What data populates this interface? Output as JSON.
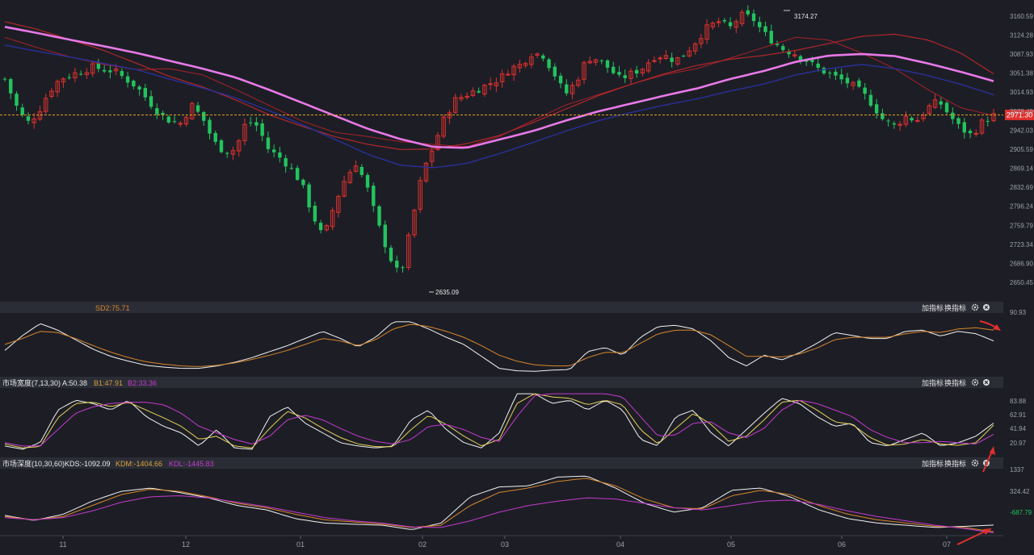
{
  "colors": {
    "background": "#1d1e25",
    "header_bar": "#2b2d36",
    "grid_text": "#9aa0aa",
    "up": "#e0302e",
    "down": "#22c45e",
    "ma_pink": "#e879e8",
    "ma_blue": "#2a2f9a",
    "ma_red": "#b3262b",
    "ma_thin_red": "#a8202a",
    "last_price_line": "#e0a020",
    "last_price_box": "#e0302e",
    "white_line": "#f2f2f2",
    "orange_line": "#d7862c",
    "magenta_line": "#c43ad0",
    "yellow_line": "#e6d25a",
    "arrow": "#e0302e",
    "green_text": "#22c45e"
  },
  "toolbar": {
    "add_label": "加指标",
    "switch_label": "换指标",
    "settings_icon": "gear-icon",
    "close_icon": "close-icon"
  },
  "x_axis": {
    "ticks": [
      "11",
      "12",
      "01",
      "02",
      "03",
      "04",
      "05",
      "06",
      "07"
    ]
  },
  "chart_data": [
    {
      "type": "candlestick",
      "panel": "price",
      "y_ticks": [
        "3160.59",
        "3124.28",
        "3087.93",
        "3051.38",
        "3014.93",
        "2978.49",
        "2942.03",
        "2905.59",
        "2869.14",
        "2832.69",
        "2796.24",
        "2759.79",
        "2723.34",
        "2686.90",
        "2650.45"
      ],
      "ylim": [
        2650.45,
        3160.59
      ],
      "last_price": "2971.30",
      "annotations": {
        "high": "3174.27",
        "low": "2635.09"
      },
      "anchors_close": [
        3040,
        2990,
        2955,
        2975,
        3015,
        3040,
        3048,
        3055,
        3063,
        3058,
        3055,
        3040,
        3025,
        3000,
        2975,
        2960,
        2955,
        2990,
        2965,
        2920,
        2900,
        2905,
        2960,
        2950,
        2905,
        2890,
        2870,
        2840,
        2780,
        2735,
        2800,
        2850,
        2880,
        2830,
        2760,
        2700,
        2660,
        2760,
        2860,
        2910,
        2965,
        3000,
        3010,
        3020,
        3030,
        3040,
        3060,
        3068,
        3090,
        3085,
        3050,
        3010,
        3035,
        3080,
        3078,
        3060,
        3040,
        3050,
        3060,
        3082,
        3085,
        3075,
        3090,
        3115,
        3140,
        3150,
        3138,
        3162,
        3158,
        3130,
        3110,
        3095,
        3088,
        3075,
        3060,
        3050,
        3040,
        3030,
        3015,
        2990,
        2960,
        2950,
        2968,
        2960,
        2985,
        2998,
        2970,
        2945,
        2932,
        2958,
        2970
      ],
      "ma_pink": [
        3140,
        3128,
        3115,
        3103,
        3090,
        3075,
        3060,
        3043,
        3020,
        2995,
        2970,
        2945,
        2925,
        2910,
        2908,
        2924,
        2940,
        2960,
        2978,
        2993,
        3008,
        3022,
        3040,
        3055,
        3073,
        3085,
        3088,
        3084,
        3070,
        3054,
        3036
      ],
      "ma_blue": [
        3105,
        3093,
        3082,
        3070,
        3058,
        3040,
        3023,
        3004,
        2980,
        2953,
        2925,
        2896,
        2875,
        2870,
        2878,
        2897,
        2918,
        2940,
        2960,
        2976,
        2990,
        3002,
        3017,
        3030,
        3048,
        3060,
        3068,
        3060,
        3047,
        3030,
        3010
      ],
      "ma_red": [
        3150,
        3135,
        3115,
        3095,
        3070,
        3045,
        3025,
        3000,
        2972,
        2950,
        2930,
        2915,
        2905,
        2906,
        2916,
        2932,
        2956,
        2982,
        3008,
        3030,
        3050,
        3066,
        3078,
        3085,
        3095,
        3108,
        3122,
        3126,
        3115,
        3090,
        3050
      ],
      "ma_thin_red": [
        3120,
        3100,
        3082,
        3068,
        3058,
        3060,
        3048,
        3020,
        2990,
        2960,
        2938,
        2930,
        2920,
        2915,
        2910,
        2930,
        2960,
        2990,
        3010,
        3030,
        3048,
        3060,
        3080,
        3100,
        3120,
        3115,
        3090,
        3060,
        3020,
        2985,
        2970
      ]
    },
    {
      "type": "line",
      "panel": "indicator_1",
      "legend": "SD2:75.71",
      "y_ticks": [
        "90.93"
      ],
      "series": [
        {
          "color": "white",
          "values": [
            40,
            65,
            85,
            74,
            58,
            42,
            30,
            22,
            15,
            12,
            10,
            10,
            14,
            20,
            28,
            38,
            48,
            60,
            72,
            60,
            46,
            62,
            88,
            88,
            76,
            62,
            50,
            30,
            10,
            6,
            5,
            7,
            8,
            38,
            45,
            32,
            62,
            80,
            82,
            76,
            56,
            28,
            14,
            32,
            24,
            36,
            52,
            70,
            65,
            60,
            60,
            72,
            74,
            64,
            72,
            68,
            56
          ]
        },
        {
          "color": "orange",
          "values": [
            50,
            60,
            72,
            70,
            60,
            48,
            37,
            28,
            21,
            17,
            14,
            13,
            15,
            19,
            25,
            32,
            40,
            50,
            60,
            56,
            48,
            58,
            76,
            84,
            80,
            72,
            62,
            48,
            32,
            22,
            16,
            14,
            14,
            28,
            37,
            36,
            52,
            68,
            74,
            74,
            66,
            48,
            30,
            30,
            29,
            34,
            44,
            58,
            62,
            62,
            62,
            68,
            72,
            70,
            76,
            78,
            74
          ]
        }
      ]
    },
    {
      "type": "line",
      "panel": "market_breadth",
      "legend": {
        "name": "市场宽度(7,13,30)",
        "A": "A:50.38",
        "B1": "B1:47.91",
        "B2": "B2:33.36"
      },
      "y_ticks": [
        "83.88",
        "62.91",
        "41.94",
        "20.97"
      ],
      "series": [
        {
          "name": "A",
          "color": "white",
          "values": [
            15,
            10,
            20,
            70,
            85,
            80,
            70,
            85,
            60,
            45,
            35,
            15,
            40,
            12,
            10,
            60,
            75,
            50,
            35,
            20,
            15,
            12,
            15,
            55,
            70,
            40,
            20,
            12,
            35,
            95,
            95,
            80,
            85,
            70,
            85,
            70,
            25,
            15,
            60,
            70,
            35,
            15,
            40,
            65,
            88,
            80,
            60,
            45,
            50,
            20,
            15,
            25,
            35,
            15,
            20,
            30,
            50
          ]
        },
        {
          "name": "B1",
          "color": "yellow",
          "values": [
            18,
            12,
            14,
            58,
            80,
            82,
            75,
            82,
            70,
            58,
            45,
            25,
            30,
            15,
            12,
            42,
            68,
            58,
            42,
            28,
            18,
            14,
            14,
            40,
            62,
            48,
            30,
            15,
            25,
            80,
            95,
            90,
            88,
            78,
            85,
            78,
            40,
            18,
            42,
            65,
            48,
            22,
            30,
            55,
            82,
            85,
            70,
            52,
            48,
            28,
            16,
            18,
            25,
            18,
            16,
            20,
            47
          ]
        },
        {
          "name": "B2",
          "color": "magenta",
          "values": [
            20,
            15,
            15,
            40,
            65,
            75,
            80,
            82,
            82,
            78,
            65,
            45,
            35,
            25,
            18,
            30,
            55,
            62,
            55,
            42,
            30,
            22,
            18,
            25,
            45,
            48,
            40,
            28,
            22,
            60,
            92,
            95,
            95,
            95,
            95,
            90,
            60,
            30,
            32,
            50,
            52,
            35,
            28,
            42,
            70,
            85,
            80,
            70,
            60,
            40,
            28,
            20,
            20,
            22,
            20,
            18,
            33
          ]
        }
      ]
    },
    {
      "type": "line",
      "panel": "market_depth",
      "legend": {
        "name": "市场深度(10,30,60)",
        "KDS": "KDS:-1092.09",
        "KDM": "KDM:-1404.66",
        "KDL": "KDL:-1445.83"
      },
      "y_ticks": [
        "1337",
        "324.42",
        "-687.79"
      ],
      "series": [
        {
          "name": "KDS",
          "color": "white",
          "values": [
            -650,
            -880,
            -600,
            0,
            450,
            600,
            400,
            150,
            -200,
            -400,
            -800,
            -1000,
            -1050,
            -1100,
            -1300,
            -1000,
            200,
            650,
            700,
            1100,
            1150,
            600,
            -100,
            -500,
            -300,
            500,
            600,
            200,
            -400,
            -800,
            -1000,
            -1100,
            -1200,
            -1150,
            -1090
          ]
        },
        {
          "name": "KDM",
          "color": "orange",
          "values": [
            -700,
            -850,
            -700,
            -200,
            300,
            550,
            450,
            200,
            -100,
            -300,
            -600,
            -850,
            -950,
            -1050,
            -1200,
            -1100,
            -200,
            400,
            600,
            900,
            1050,
            700,
            100,
            -300,
            -350,
            250,
            500,
            300,
            -200,
            -600,
            -850,
            -1000,
            -1150,
            -1200,
            -1400
          ]
        },
        {
          "name": "KDL",
          "color": "magenta",
          "values": [
            -750,
            -850,
            -750,
            -450,
            -50,
            200,
            250,
            150,
            -50,
            -250,
            -500,
            -750,
            -900,
            -1000,
            -1180,
            -1200,
            -900,
            -500,
            -200,
            0,
            150,
            100,
            -100,
            -300,
            -400,
            -200,
            0,
            50,
            -150,
            -450,
            -700,
            -900,
            -1100,
            -1250,
            -1445
          ]
        }
      ]
    }
  ]
}
